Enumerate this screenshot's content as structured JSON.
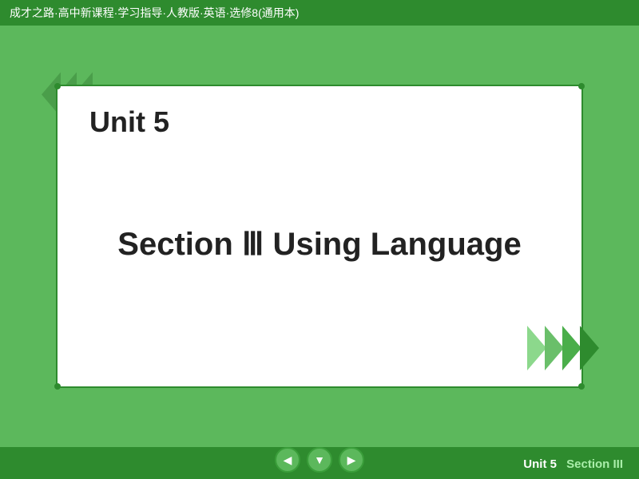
{
  "header": {
    "title": "成才之路·高中新课程·学习指导·人教版·英语·选修8(通用本)"
  },
  "content": {
    "unit_label": "Unit 5",
    "section_label": "Section Ⅲ    Using Language"
  },
  "bottom": {
    "unit_text": "Unit 5",
    "section_text": "Section III",
    "nav_prev_label": "◀",
    "nav_home_label": "▼",
    "nav_next_label": "▶"
  }
}
